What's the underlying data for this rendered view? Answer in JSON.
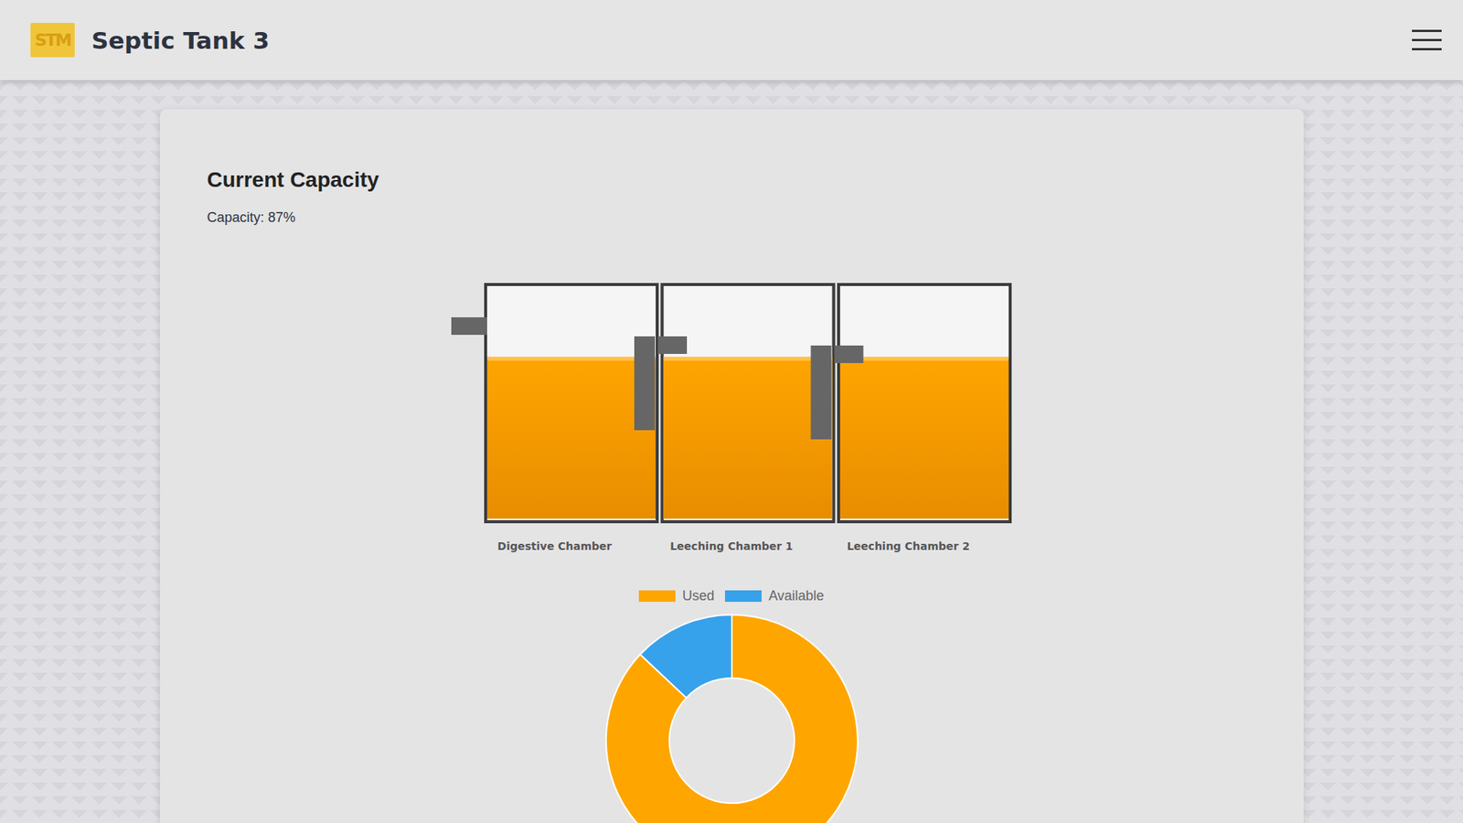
{
  "header": {
    "logo": "STM",
    "title": "Septic Tank 3"
  },
  "capacity": {
    "heading": "Current Capacity",
    "reading": "Capacity: 87%"
  },
  "chambers": [
    {
      "name": "Digestive Chamber",
      "level": 0.7
    },
    {
      "name": "Leeching Chamber 1",
      "level": 0.7
    },
    {
      "name": "Leeching Chamber 2",
      "level": 0.7
    }
  ],
  "chart": {
    "legend": [
      {
        "label": "Used",
        "color": "#ffa500"
      },
      {
        "label": "Available",
        "color": "#36a2eb"
      }
    ],
    "values": [
      87,
      13
    ]
  }
}
